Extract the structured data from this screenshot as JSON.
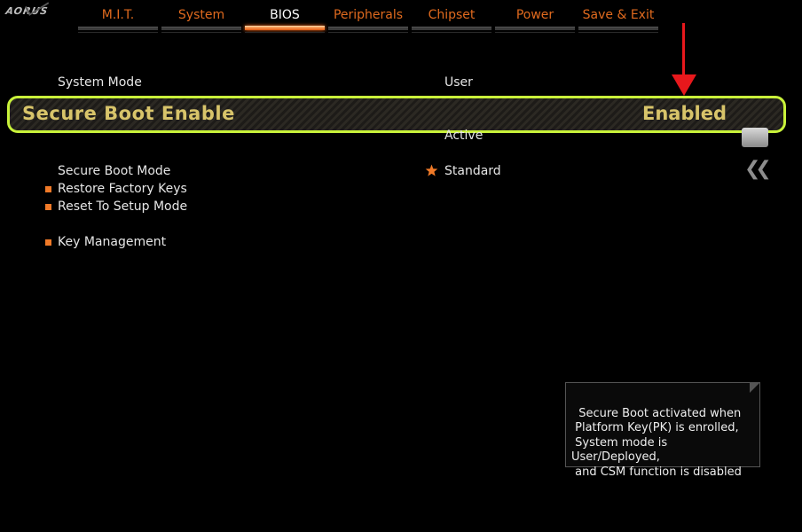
{
  "brand": "AORUS",
  "tabs": [
    {
      "label": "M.I.T."
    },
    {
      "label": "System"
    },
    {
      "label": "BIOS"
    },
    {
      "label": "Peripherals"
    },
    {
      "label": "Chipset"
    },
    {
      "label": "Power"
    },
    {
      "label": "Save & Exit"
    }
  ],
  "active_tab": "BIOS",
  "settings": {
    "system_mode": {
      "label": "System Mode",
      "value": "User"
    },
    "secure_boot_enable": {
      "label": "Secure Boot Enable",
      "value": "Enabled"
    },
    "secure_boot_status": {
      "value": "Active"
    },
    "secure_boot_mode": {
      "label": "Secure Boot Mode",
      "value": "Standard"
    },
    "restore_factory_keys": {
      "label": "Restore Factory Keys"
    },
    "reset_to_setup_mode": {
      "label": "Reset To Setup Mode"
    },
    "key_management": {
      "label": "Key Management"
    }
  },
  "help_text": "Secure Boot activated when\n Platform Key(PK) is enrolled,\n System mode is\nUser/Deployed,\n and CSM function is disabled",
  "colors": {
    "accent": "#e06a1e",
    "highlight_border": "#c9f23a",
    "highlight_text": "#d8c46a",
    "annotation_arrow": "#e8181c"
  },
  "icons": {
    "collapse": "double-chevron-left-icon",
    "mode_marker": "star-icon",
    "side_panel": "keyboard-icon"
  }
}
